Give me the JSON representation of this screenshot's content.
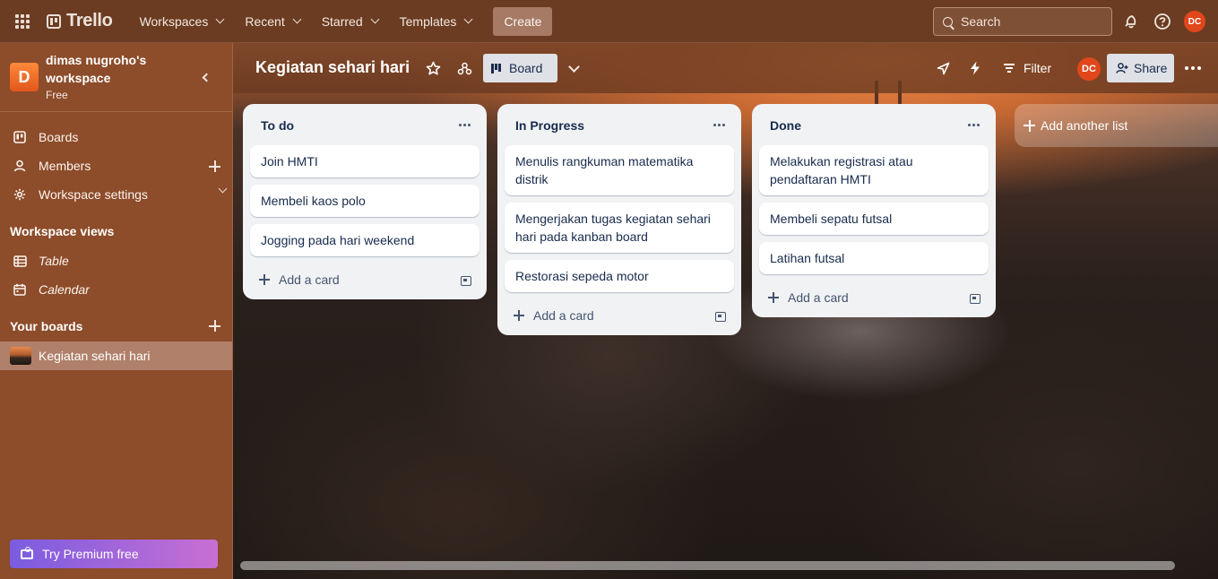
{
  "topbar": {
    "brand": "Trello",
    "menu": [
      {
        "label": "Workspaces"
      },
      {
        "label": "Recent"
      },
      {
        "label": "Starred"
      },
      {
        "label": "Templates"
      }
    ],
    "create_label": "Create",
    "search_placeholder": "Search",
    "user_initials": "DC"
  },
  "sidebar": {
    "workspace_initial": "D",
    "workspace_name": "dimas nugroho's workspace",
    "workspace_plan": "Free",
    "items": [
      {
        "label": "Boards",
        "icon": "trello-board-icon"
      },
      {
        "label": "Members",
        "icon": "person-icon"
      },
      {
        "label": "Workspace settings",
        "icon": "gear-icon"
      }
    ],
    "views_heading": "Workspace views",
    "views": [
      {
        "label": "Table",
        "icon": "table-icon"
      },
      {
        "label": "Calendar",
        "icon": "calendar-icon"
      }
    ],
    "boards_heading": "Your boards",
    "boards": [
      {
        "label": "Kegiatan sehari hari"
      }
    ],
    "premium_label": "Try Premium free"
  },
  "board": {
    "title": "Kegiatan sehari hari",
    "view_label": "Board",
    "filter_label": "Filter",
    "share_label": "Share",
    "member_initials": "DC",
    "lists": [
      {
        "title": "To do",
        "cards": [
          "Join HMTI",
          "Membeli kaos polo",
          "Jogging pada hari weekend"
        ],
        "add_label": "Add a card"
      },
      {
        "title": "In Progress",
        "cards": [
          "Menulis rangkuman matematika distrik",
          "Mengerjakan tugas kegiatan sehari hari pada kanban board",
          "Restorasi sepeda motor"
        ],
        "add_label": "Add a card"
      },
      {
        "title": "Done",
        "cards": [
          "Melakukan registrasi atau pendaftaran HMTI",
          "Membeli sepatu futsal",
          "Latihan futsal"
        ],
        "add_label": "Add a card"
      }
    ],
    "add_list_label": "Add another list"
  },
  "colors": {
    "topbar": "#6b3c21",
    "sidebar": "#8d4c2a",
    "avatar": "#e2461b",
    "premium_start": "#7a5ce0",
    "premium_end": "#c86fd3"
  }
}
